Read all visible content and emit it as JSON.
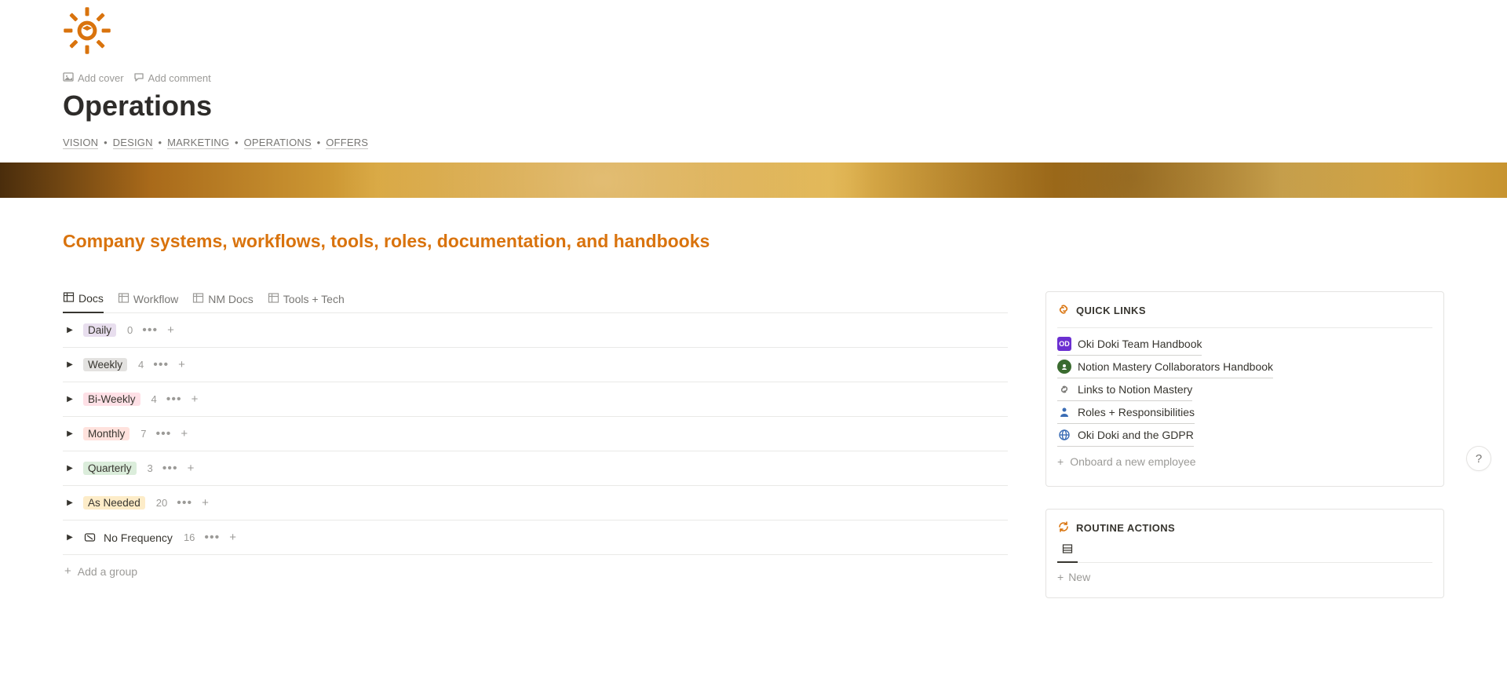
{
  "header": {
    "actions": {
      "add_cover": "Add cover",
      "add_comment": "Add comment"
    },
    "title": "Operations",
    "breadcrumb": [
      {
        "label": "VISION"
      },
      {
        "label": "DESIGN"
      },
      {
        "label": "MARKETING"
      },
      {
        "label": "OPERATIONS"
      },
      {
        "label": "OFFERS"
      }
    ]
  },
  "subtitle": "Company systems, workflows, tools, roles, documentation, and handbooks",
  "tabs": [
    {
      "label": "Docs",
      "active": true
    },
    {
      "label": "Workflow",
      "active": false
    },
    {
      "label": "NM Docs",
      "active": false
    },
    {
      "label": "Tools + Tech",
      "active": false
    }
  ],
  "groups": [
    {
      "label": "Daily",
      "count": "0",
      "bg": "#e8deee",
      "fg": "#37352f"
    },
    {
      "label": "Weekly",
      "count": "4",
      "bg": "#e3e2e0",
      "fg": "#37352f"
    },
    {
      "label": "Bi-Weekly",
      "count": "4",
      "bg": "#fee0e6",
      "fg": "#37352f"
    },
    {
      "label": "Monthly",
      "count": "7",
      "bg": "#ffe2dd",
      "fg": "#37352f"
    },
    {
      "label": "Quarterly",
      "count": "3",
      "bg": "#dbeddb",
      "fg": "#37352f"
    },
    {
      "label": "As Needed",
      "count": "20",
      "bg": "#fdecc8",
      "fg": "#37352f"
    }
  ],
  "no_frequency": {
    "label": "No Frequency",
    "count": "16"
  },
  "add_group_label": "Add a group",
  "quick_links": {
    "title": "QUICK LINKS",
    "items": [
      {
        "label": "Oki Doki Team Handbook",
        "icon_type": "box",
        "icon_text": "OD",
        "icon_bg": "#6b2fd1",
        "icon_fg": "#fff"
      },
      {
        "label": "Notion Mastery Collaborators Handbook",
        "icon_type": "circle",
        "icon_bg": "#3a6b2f",
        "icon_fg": "#fff"
      },
      {
        "label": "Links to Notion Mastery",
        "icon_type": "link"
      },
      {
        "label": "Roles + Responsibilities",
        "icon_type": "person"
      },
      {
        "label": "Oki Doki and the GDPR",
        "icon_type": "globe"
      }
    ],
    "onboard_label": "Onboard a new employee"
  },
  "routine_actions": {
    "title": "ROUTINE ACTIONS",
    "new_label": "New"
  },
  "help_label": "?"
}
